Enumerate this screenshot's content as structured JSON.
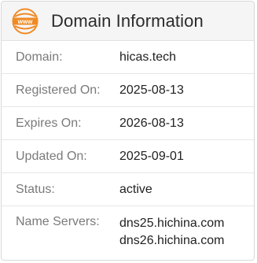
{
  "header": {
    "icon": "www-globe-icon",
    "icon_text": "www",
    "title": "Domain Information",
    "accent_color": "#f08a24"
  },
  "rows": [
    {
      "label": "Domain:",
      "value": "hicas.tech"
    },
    {
      "label": "Registered On:",
      "value": "2025-08-13"
    },
    {
      "label": "Expires On:",
      "value": "2026-08-13"
    },
    {
      "label": "Updated On:",
      "value": "2025-09-01"
    },
    {
      "label": "Status:",
      "value": "active"
    }
  ],
  "name_servers": {
    "label": "Name Servers:",
    "values": [
      "dns25.hichina.com",
      "dns26.hichina.com"
    ]
  }
}
